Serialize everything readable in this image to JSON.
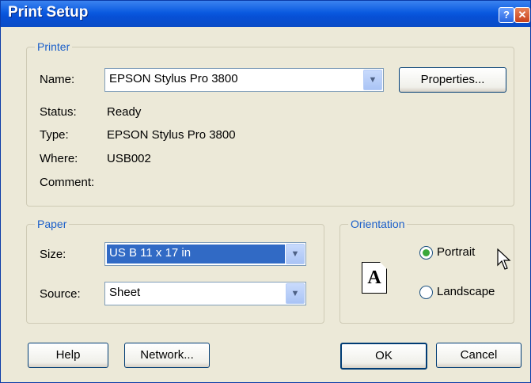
{
  "window": {
    "title": "Print Setup",
    "help_label": "?",
    "close_label": "✕"
  },
  "printer": {
    "legend": "Printer",
    "name_label": "Name:",
    "name_value": "EPSON Stylus Pro 3800",
    "properties_label": "Properties...",
    "status_label": "Status:",
    "status_value": "Ready",
    "type_label": "Type:",
    "type_value": "EPSON Stylus Pro 3800",
    "where_label": "Where:",
    "where_value": "USB002",
    "comment_label": "Comment:"
  },
  "paper": {
    "legend": "Paper",
    "size_label": "Size:",
    "size_value": "US B 11 x 17 in",
    "source_label": "Source:",
    "source_value": "Sheet"
  },
  "orientation": {
    "legend": "Orientation",
    "page_glyph": "A",
    "portrait_label": "Portrait",
    "landscape_label": "Landscape",
    "selected": "Portrait"
  },
  "buttons": {
    "help": "Help",
    "network": "Network...",
    "ok": "OK",
    "cancel": "Cancel"
  },
  "colors": {
    "titlebar": "#0a5ae0",
    "legend": "#1b5fc9",
    "selection": "#316ac5",
    "dialog_bg": "#ece9d8"
  }
}
